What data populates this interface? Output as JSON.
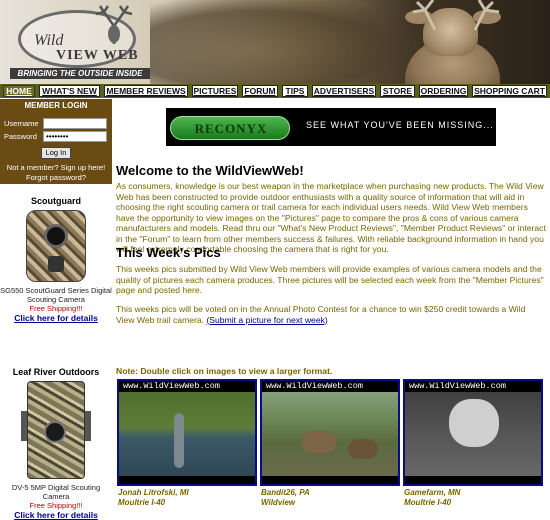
{
  "brand": {
    "logo_text_1": "Wild",
    "logo_text_2": "VIEW WEB",
    "tagline": "BRINGING THE OUTSIDE INSIDE"
  },
  "nav": {
    "items": [
      "HOME",
      "WHAT'S NEW",
      "MEMBER REVIEWS",
      "PICTURES",
      "FORUM",
      "TIPS",
      "ADVERTISERS",
      "STORE",
      "ORDERING",
      "SHOPPING CART"
    ]
  },
  "login": {
    "title": "MEMBER LOGIN",
    "username_label": "Username",
    "username_value": "",
    "password_label": "Password",
    "password_value": "••••••••",
    "button": "Log In",
    "signup": "Not a member? Sign up here!",
    "forgot": "Forgot password?"
  },
  "ads": [
    {
      "title": "Scoutguard",
      "desc": "SG550 ScoutGuard Series Digital Scouting Camera",
      "shipping": "Free Shipping!!!",
      "link": "Click here for details"
    },
    {
      "title": "Leaf River Outdoors",
      "desc": "DV-5 5MP Digital Scouting Camera",
      "shipping": "Free Shipping!!!",
      "link": "Click here for details"
    }
  ],
  "banner": {
    "logo": "RECONYX",
    "tagline": "SEE WHAT YOU'VE BEEN MISSING..."
  },
  "main": {
    "welcome_title": "Welcome to the WildViewWeb!",
    "welcome_text": "As consumers, knowledge is our best weapon in the marketplace when purchasing new products. The Wild View Web has been constructed to provide outdoor enthusiasts with a quality source of information that will aid in choosing the right scouting camera or trail camera for each individual users needs. Wild View Web members have the opportunity to view images on the \"Pictures\" page to compare the pros & cons of various camera manufacturers and models. Read thru our \"What's New Product Reviews\", \"Member Product Reviews\" or interact in the \"Forum\" to learn from other members success & failures. With reliable background information in hand you will feel extremely comfortable choosing the camera that is right for you.",
    "pics_title": "This Week's Pics",
    "pics_text": "This weeks pics submitted by Wild View Web members will provide examples of various camera models and the quality of pictures each camera produces. Three pictures will be selected each week from the \"Member Pictures\" page and posted here.",
    "contest_text": "This weeks pics will be voted on in the Annual Photo Contest for a chance to win $250 credit towards a Wild View Web trail camera.",
    "contest_link": "(Submit a picture for next week)",
    "note": "Note: Double click on images to view a larger format."
  },
  "photos": [
    {
      "stamp": "www.WildViewWeb.com",
      "user": "Jonah Litrofski, MI",
      "camera": "Moultrie I-40"
    },
    {
      "stamp": "www.WildViewWeb.com",
      "user": "Bandit26, PA",
      "camera": "Wildview"
    },
    {
      "stamp": "www.WildViewWeb.com",
      "user": "Gamefarm, MN",
      "camera": "Moultrie I-40"
    }
  ],
  "colors": {
    "nav_bg": "#5b6018",
    "login_bg": "#6b4b14",
    "body_text": "#7a6500",
    "link": "#00008b",
    "photo_border": "#0b0b8a"
  }
}
